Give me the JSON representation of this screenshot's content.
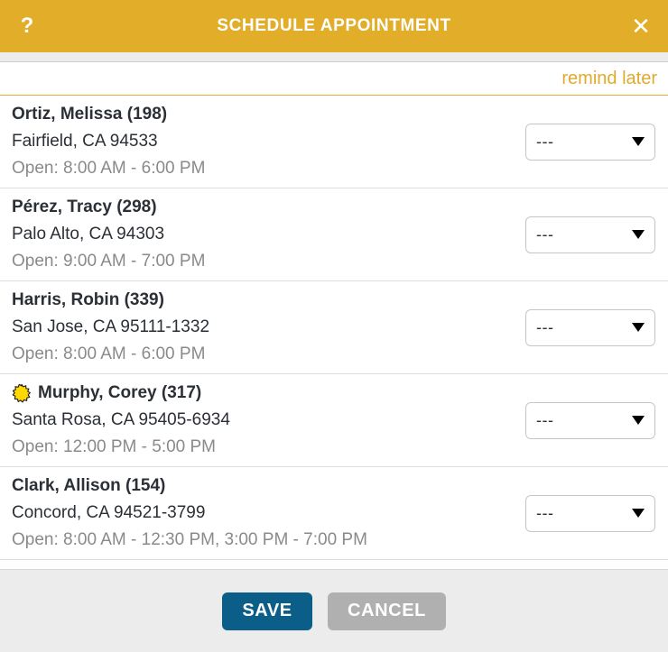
{
  "titlebar": {
    "title": "SCHEDULE APPOINTMENT",
    "help_label": "?",
    "close_label": "✕"
  },
  "subbar": {
    "remind_later_label": "remind later"
  },
  "list": {
    "rows": [
      {
        "name": "Ortiz, Melissa (198)",
        "address": "Fairfield, CA 94533",
        "hours": "Open: 8:00 AM - 6:00 PM",
        "starred": false,
        "slot_value": "---"
      },
      {
        "name": "Pérez, Tracy (298)",
        "address": "Palo Alto, CA 94303",
        "hours": "Open: 9:00 AM - 7:00 PM",
        "starred": false,
        "slot_value": "---"
      },
      {
        "name": "Harris, Robin (339)",
        "address": "San Jose, CA 95111-1332",
        "hours": "Open: 8:00 AM - 6:00 PM",
        "starred": false,
        "slot_value": "---"
      },
      {
        "name": "Murphy, Corey (317)",
        "address": "Santa Rosa, CA 95405-6934",
        "hours": "Open: 12:00 PM - 5:00 PM",
        "starred": true,
        "slot_value": "---"
      },
      {
        "name": "Clark, Allison (154)",
        "address": "Concord, CA 94521-3799",
        "hours": "Open: 8:00 AM - 12:30 PM, 3:00 PM - 7:00 PM",
        "starred": false,
        "slot_value": "---"
      }
    ]
  },
  "footer": {
    "save_label": "SAVE",
    "cancel_label": "CANCEL"
  },
  "colors": {
    "header_gold": "#e2ae29",
    "link_gold": "#e0ab2c",
    "save_blue": "#0b5e87",
    "cancel_gray": "#b0b0b0",
    "footer_bg": "#ececec",
    "text_dark": "#2b3036",
    "text_muted": "#8a8a8a",
    "star_yellow": "#ffd800"
  }
}
